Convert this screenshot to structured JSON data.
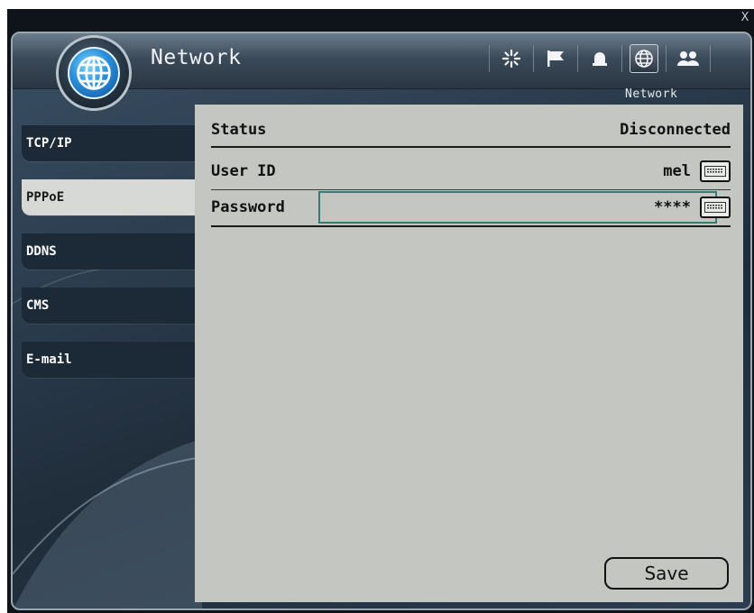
{
  "window": {
    "close_label": "X"
  },
  "header": {
    "title": "Network",
    "section_label": "Network",
    "toolbar": [
      {
        "icon": "sparkle-icon",
        "active": false
      },
      {
        "icon": "flag-icon",
        "active": false
      },
      {
        "icon": "alarm-bell-icon",
        "active": false
      },
      {
        "icon": "globe-icon",
        "active": true
      },
      {
        "icon": "users-icon",
        "active": false
      }
    ]
  },
  "sidebar": {
    "items": [
      {
        "label": "TCP/IP",
        "selected": false
      },
      {
        "label": "PPPoE",
        "selected": true
      },
      {
        "label": "DDNS",
        "selected": false
      },
      {
        "label": "CMS",
        "selected": false
      },
      {
        "label": "E-mail",
        "selected": false
      }
    ]
  },
  "pppoe": {
    "status_label": "Status",
    "status_value": "Disconnected",
    "user_id_label": "User ID",
    "user_id_value": "mel",
    "password_label": "Password",
    "password_value": "****",
    "save_label": "Save"
  },
  "colors": {
    "panel_bg": "#c4c6c2",
    "sidebar_item_bg": "#1c2a37",
    "sidebar_selected_bg": "#d7d9d6",
    "focus_border": "#2f7f72"
  }
}
